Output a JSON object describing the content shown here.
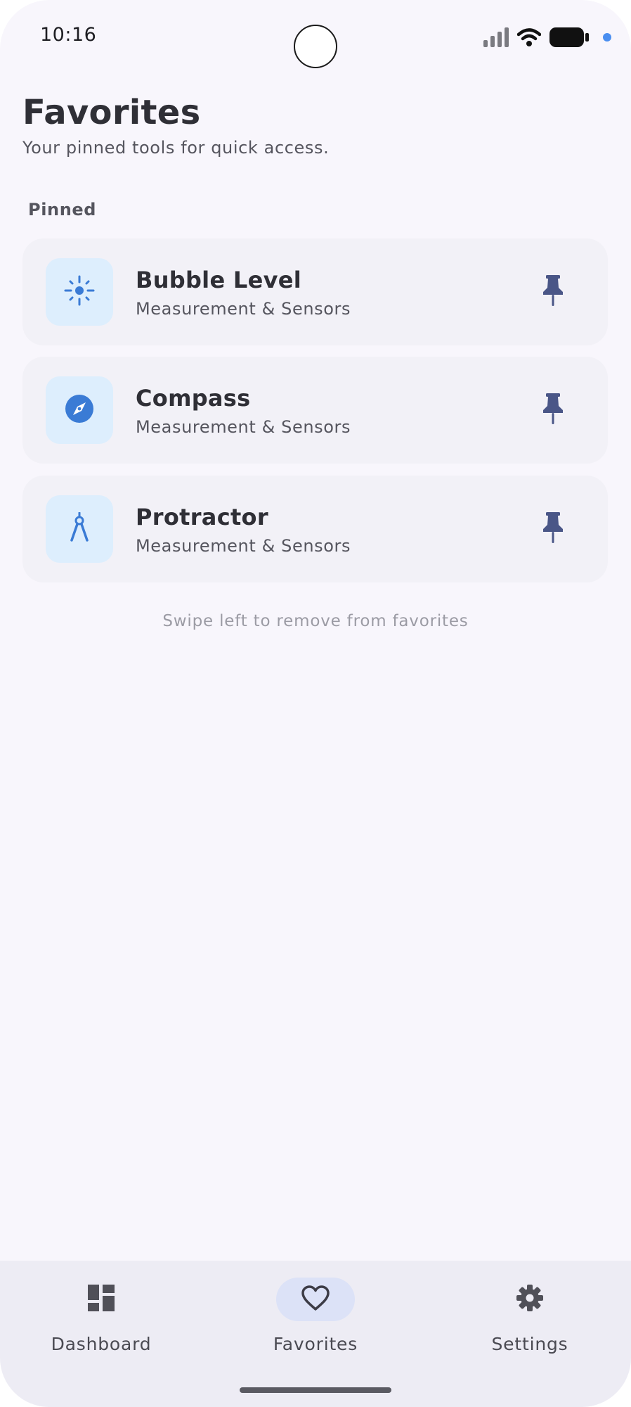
{
  "status_bar": {
    "time": "10:16"
  },
  "header": {
    "title": "Favorites",
    "subtitle": "Your pinned tools for quick access."
  },
  "section": {
    "label": "Pinned"
  },
  "items": [
    {
      "title": "Bubble Level",
      "subtitle": "Measurement & Sensors",
      "icon": "level-icon",
      "pinned": true
    },
    {
      "title": "Compass",
      "subtitle": "Measurement & Sensors",
      "icon": "compass-icon",
      "pinned": true
    },
    {
      "title": "Protractor",
      "subtitle": "Measurement & Sensors",
      "icon": "protractor-icon",
      "pinned": true
    }
  ],
  "hint": "Swipe left to remove from favorites",
  "nav": {
    "items": [
      {
        "label": "Dashboard",
        "icon": "dashboard-icon",
        "active": false
      },
      {
        "label": "Favorites",
        "icon": "heart-icon",
        "active": true
      },
      {
        "label": "Settings",
        "icon": "gear-icon",
        "active": false
      }
    ]
  },
  "colors": {
    "background": "#f8f6fc",
    "card": "#f2f1f7",
    "icon_tile": "#ddeefd",
    "accent_blue": "#3a7bd5",
    "pin": "#4a5687",
    "nav_background": "#edecf4",
    "nav_active_pill": "#dce2f7"
  }
}
